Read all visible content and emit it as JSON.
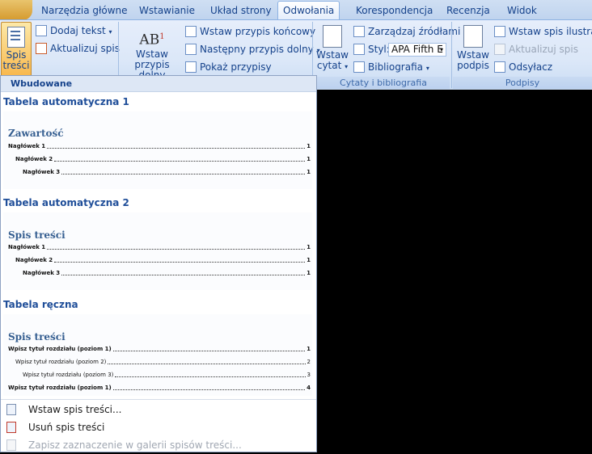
{
  "tabs": [
    {
      "label": "Narzędzia główne"
    },
    {
      "label": "Wstawianie"
    },
    {
      "label": "Układ strony"
    },
    {
      "label": "Odwołania",
      "active": true
    },
    {
      "label": "Korespondencja"
    },
    {
      "label": "Recenzja"
    },
    {
      "label": "Widok"
    }
  ],
  "ribbon": {
    "toc_group": {
      "spis_tresci": "Spis treści",
      "spis_line1": "Spis",
      "spis_line2": "treści",
      "dodaj_tekst": "Dodaj tekst",
      "aktualizuj_spis": "Aktualizuj spis"
    },
    "footnotes_group": {
      "wstaw_line1": "Wstaw",
      "wstaw_line2": "przypis dolny",
      "wstaw_przypis_koncowy": "Wstaw przypis końcowy",
      "nastepny_przypis_dolny": "Następny przypis dolny",
      "pokaz_przypisy": "Pokaż przypisy"
    },
    "citations_group": {
      "wstaw_cytat_line1": "Wstaw",
      "wstaw_cytat_line2": "cytat",
      "zarzadzaj_zrodlami": "Zarządzaj źródłami",
      "styl_label": "Styl:",
      "styl_value": "APA Fifth E",
      "bibliografia": "Bibliografia",
      "label": "Cytaty i bibliografia"
    },
    "captions_group": {
      "wstaw_podpis_line1": "Wstaw",
      "wstaw_podpis_line2": "podpis",
      "wstaw_spis_ilustracji": "Wstaw spis ilustracji",
      "aktualizuj_spis": "Aktualizuj spis",
      "odsylacz": "Odsyłacz",
      "label": "Podpisy"
    }
  },
  "dropdown": {
    "header": "Wbudowane",
    "sections": [
      {
        "title": "Tabela automatyczna 1",
        "preview_title": "Zawartość",
        "entries": [
          {
            "text": "Nagłówek 1",
            "page": "1"
          },
          {
            "text": "Nagłówek 2",
            "page": "1"
          },
          {
            "text": "Nagłówek 3",
            "page": "1"
          }
        ]
      },
      {
        "title": "Tabela automatyczna 2",
        "preview_title": "Spis treści",
        "entries": [
          {
            "text": "Nagłówek 1",
            "page": "1"
          },
          {
            "text": "Nagłówek 2",
            "page": "1"
          },
          {
            "text": "Nagłówek 3",
            "page": "1"
          }
        ]
      },
      {
        "title": "Tabela ręczna",
        "preview_title": "Spis treści",
        "entries": [
          {
            "text": "Wpisz tytuł rozdziału (poziom 1)",
            "page": "1"
          },
          {
            "text": "Wpisz tytuł rozdziału (poziom 2)",
            "page": "2"
          },
          {
            "text": "Wpisz tytuł rozdziału (poziom 3)",
            "page": "3"
          },
          {
            "text": "Wpisz tytuł rozdziału (poziom 1)",
            "page": "4"
          }
        ]
      }
    ],
    "menu": [
      {
        "label": "Wstaw spis treści...",
        "enabled": true
      },
      {
        "label": "Usuń spis treści",
        "enabled": true
      },
      {
        "label": "Zapisz zaznaczenie w galerii spisów treści...",
        "enabled": false
      }
    ]
  }
}
